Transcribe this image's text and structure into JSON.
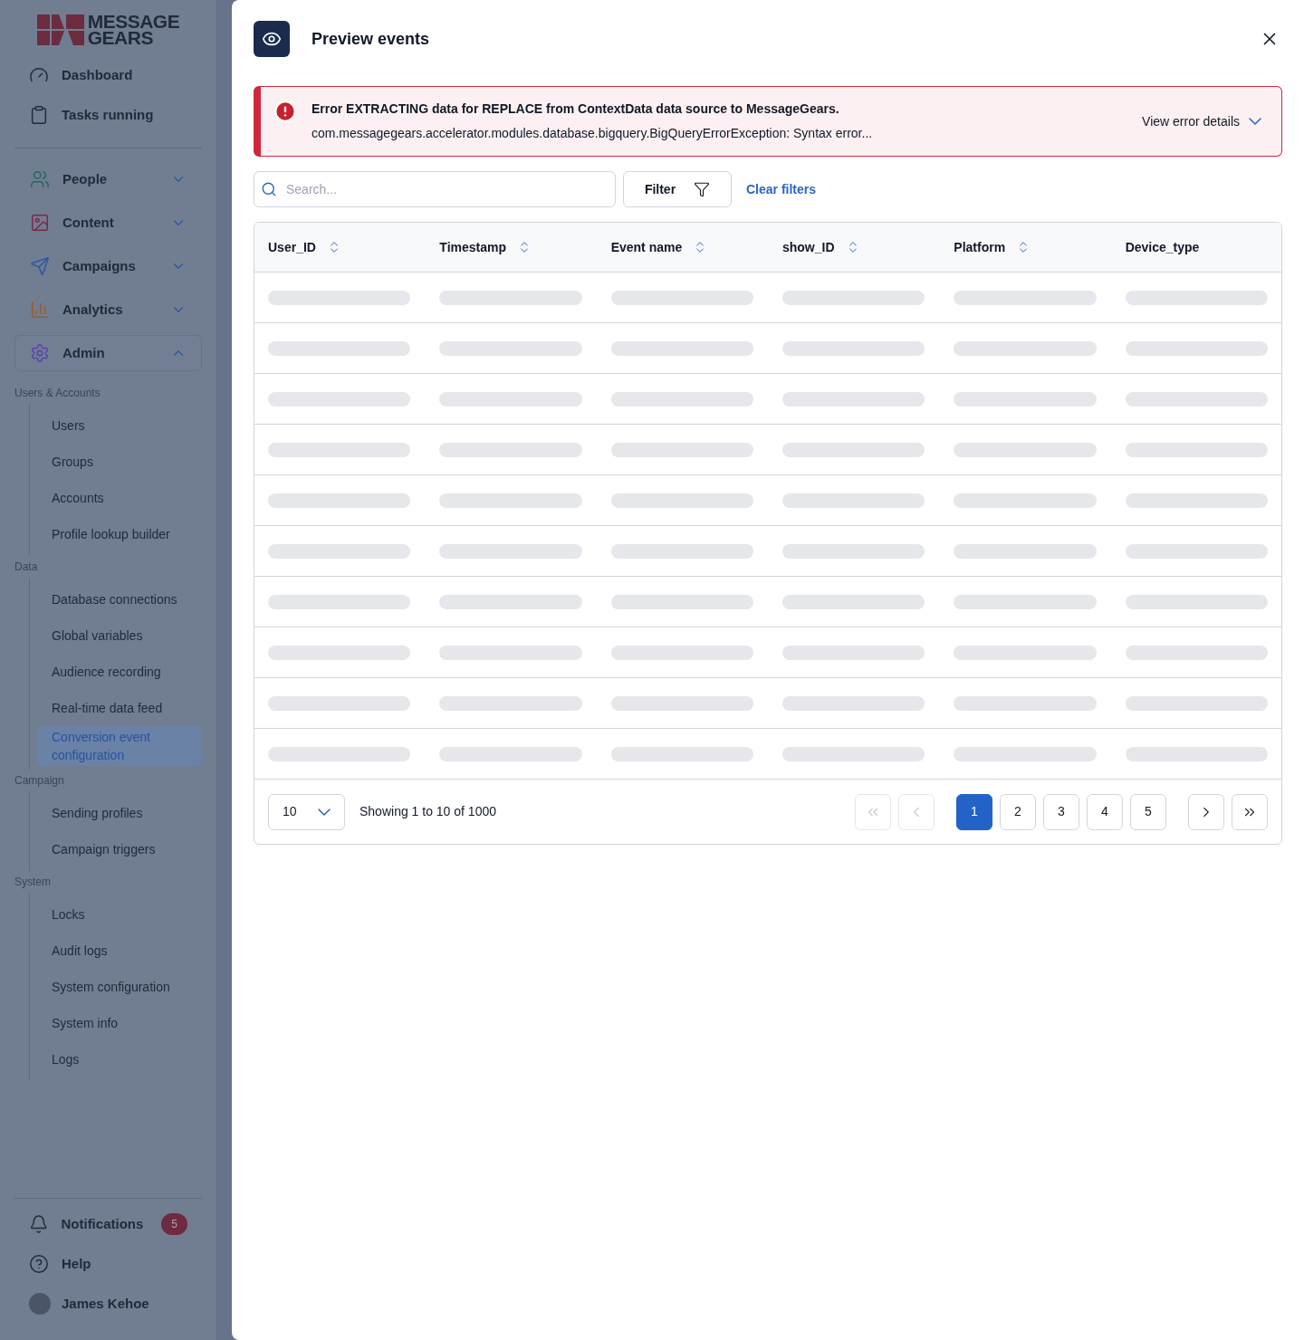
{
  "brand": {
    "line_1": "MESSAGE",
    "line_2": "GEARS"
  },
  "nav_top": [
    {
      "label": "Dashboard"
    },
    {
      "label": "Tasks running"
    }
  ],
  "nav_sections": [
    {
      "label": "People",
      "expanded": false
    },
    {
      "label": "Content",
      "expanded": false
    },
    {
      "label": "Campaigns",
      "expanded": false
    },
    {
      "label": "Analytics",
      "expanded": false
    },
    {
      "label": "Admin",
      "expanded": true
    }
  ],
  "admin_menu": [
    {
      "heading": "Users & Accounts",
      "items": [
        {
          "label": "Users",
          "selected": false
        },
        {
          "label": "Groups",
          "selected": false
        },
        {
          "label": "Accounts",
          "selected": false
        },
        {
          "label": "Profile lookup builder",
          "selected": false
        }
      ]
    },
    {
      "heading": "Data",
      "items": [
        {
          "label": "Database connections",
          "selected": false
        },
        {
          "label": "Global variables",
          "selected": false
        },
        {
          "label": "Audience recording",
          "selected": false
        },
        {
          "label": "Real-time data feed",
          "selected": false
        },
        {
          "label": "Conversion event configuration",
          "selected": true
        }
      ]
    },
    {
      "heading": "Campaign",
      "items": [
        {
          "label": "Sending profiles",
          "selected": false
        },
        {
          "label": "Campaign triggers",
          "selected": false
        }
      ]
    },
    {
      "heading": "System",
      "items": [
        {
          "label": "Locks",
          "selected": false
        },
        {
          "label": "Audit logs",
          "selected": false
        },
        {
          "label": "System configuration",
          "selected": false
        },
        {
          "label": "System info",
          "selected": false
        },
        {
          "label": "Logs",
          "selected": false
        }
      ]
    }
  ],
  "bottom": {
    "notifications": {
      "label": "Notifications",
      "badge": "5"
    },
    "help": "Help",
    "user": "James Kehoe"
  },
  "dialog": {
    "title": "Preview events",
    "error": {
      "title": "Error EXTRACTING data for REPLACE from ContextData data source to MessageGears.",
      "message": "com.messagegears.accelerator.modules.database.bigquery.BigQueryErrorException: Syntax error...",
      "details_link": "View error details"
    },
    "search": {
      "placeholder": "Search..."
    },
    "filter_button": "Filter",
    "clear_filters": "Clear filters",
    "table": {
      "columns": [
        {
          "label": "User_ID",
          "sortable": true
        },
        {
          "label": "Timestamp",
          "sortable": true
        },
        {
          "label": "Event name",
          "sortable": true
        },
        {
          "label": "show_ID",
          "sortable": true
        },
        {
          "label": "Platform",
          "sortable": true
        },
        {
          "label": "Device_type",
          "sortable": false
        }
      ]
    },
    "pagination": {
      "page_size": "10",
      "summary": "Showing 1 to 10 of 1000",
      "first_disabled": true,
      "prev_disabled": true,
      "next_disabled": false,
      "last_disabled": false,
      "pages": [
        {
          "label": "1",
          "selected": true
        },
        {
          "label": "2",
          "selected": false
        },
        {
          "label": "3",
          "selected": false
        },
        {
          "label": "4",
          "selected": false
        },
        {
          "label": "5",
          "selected": false
        }
      ]
    }
  }
}
